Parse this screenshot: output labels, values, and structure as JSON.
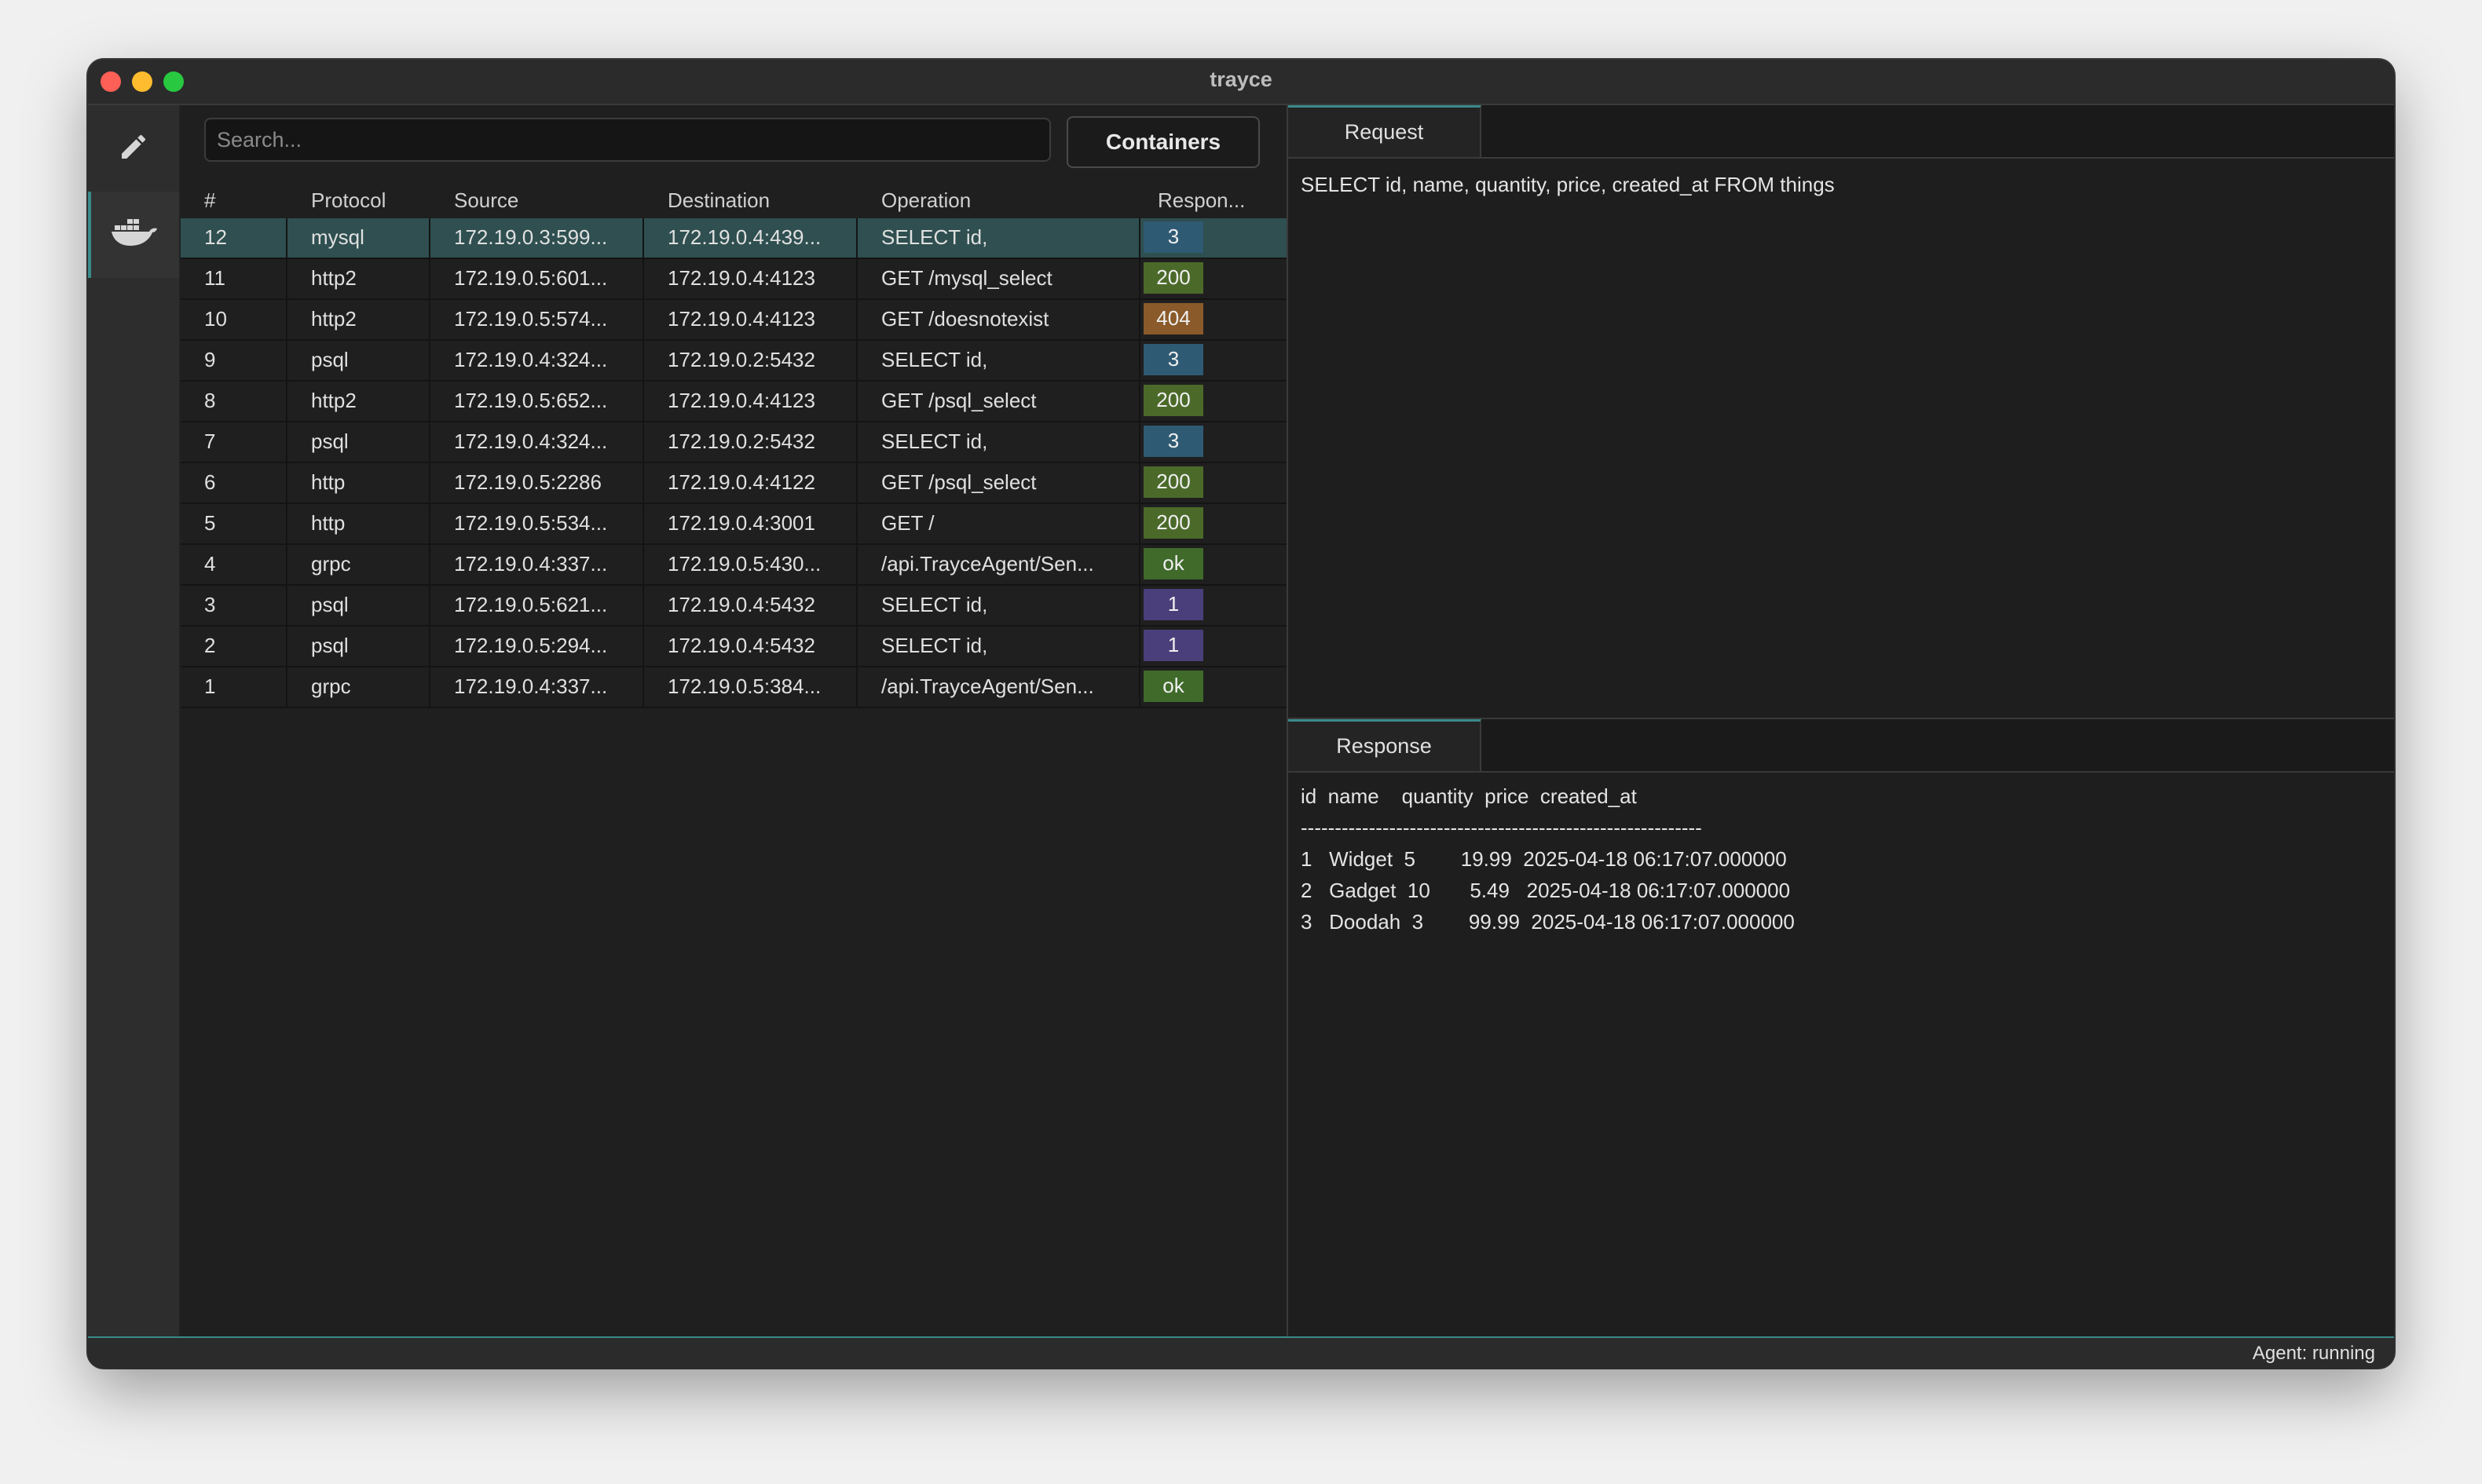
{
  "window": {
    "title": "trayce"
  },
  "sidebar": {
    "items": [
      {
        "icon": "pencil-icon",
        "active": false
      },
      {
        "icon": "docker-whale-icon",
        "active": true
      }
    ]
  },
  "toolbar": {
    "search_placeholder": "Search...",
    "containers_label": "Containers"
  },
  "table": {
    "headers": {
      "num": "#",
      "protocol": "Protocol",
      "source": "Source",
      "destination": "Destination",
      "operation": "Operation",
      "response": "Respon..."
    },
    "rows": [
      {
        "num": "12",
        "protocol": "mysql",
        "source": "172.19.0.3:599...",
        "destination": "172.19.0.4:439...",
        "operation": "SELECT id,",
        "response": "3",
        "badge_color": "#2f5a73",
        "selected": true
      },
      {
        "num": "11",
        "protocol": "http2",
        "source": "172.19.0.5:601...",
        "destination": "172.19.0.4:4123",
        "operation": "GET /mysql_select",
        "response": "200",
        "badge_color": "#4b6a2a"
      },
      {
        "num": "10",
        "protocol": "http2",
        "source": "172.19.0.5:574...",
        "destination": "172.19.0.4:4123",
        "operation": "GET /doesnotexist",
        "response": "404",
        "badge_color": "#8a5a2a"
      },
      {
        "num": "9",
        "protocol": "psql",
        "source": "172.19.0.4:324...",
        "destination": "172.19.0.2:5432",
        "operation": "SELECT id,",
        "response": "3",
        "badge_color": "#2f5a73"
      },
      {
        "num": "8",
        "protocol": "http2",
        "source": "172.19.0.5:652...",
        "destination": "172.19.0.4:4123",
        "operation": "GET /psql_select",
        "response": "200",
        "badge_color": "#4b6a2a"
      },
      {
        "num": "7",
        "protocol": "psql",
        "source": "172.19.0.4:324...",
        "destination": "172.19.0.2:5432",
        "operation": "SELECT id,",
        "response": "3",
        "badge_color": "#2f5a73"
      },
      {
        "num": "6",
        "protocol": "http",
        "source": "172.19.0.5:2286",
        "destination": "172.19.0.4:4122",
        "operation": "GET /psql_select",
        "response": "200",
        "badge_color": "#4b6a2a"
      },
      {
        "num": "5",
        "protocol": "http",
        "source": "172.19.0.5:534...",
        "destination": "172.19.0.4:3001",
        "operation": "GET /",
        "response": "200",
        "badge_color": "#4b6a2a"
      },
      {
        "num": "4",
        "protocol": "grpc",
        "source": "172.19.0.4:337...",
        "destination": "172.19.0.5:430...",
        "operation": "/api.TrayceAgent/Sen...",
        "response": "ok",
        "badge_color": "#3f6a2a"
      },
      {
        "num": "3",
        "protocol": "psql",
        "source": "172.19.0.5:621...",
        "destination": "172.19.0.4:5432",
        "operation": "SELECT id,",
        "response": "1",
        "badge_color": "#4a3f7a"
      },
      {
        "num": "2",
        "protocol": "psql",
        "source": "172.19.0.5:294...",
        "destination": "172.19.0.4:5432",
        "operation": "SELECT id,",
        "response": "1",
        "badge_color": "#4a3f7a"
      },
      {
        "num": "1",
        "protocol": "grpc",
        "source": "172.19.0.4:337...",
        "destination": "172.19.0.5:384...",
        "operation": "/api.TrayceAgent/Sen...",
        "response": "ok",
        "badge_color": "#3f6a2a"
      }
    ]
  },
  "request": {
    "tab_label": "Request",
    "body": "SELECT id, name, quantity, price, created_at FROM things"
  },
  "response": {
    "tab_label": "Response",
    "lines": [
      "id  name    quantity  price  created_at",
      "-----------------------------------------------------------",
      "1   Widget  5        19.99  2025-04-18 06:17:07.000000",
      "2   Gadget  10       5.49   2025-04-18 06:17:07.000000",
      "3   Doodah  3        99.99  2025-04-18 06:17:07.000000"
    ]
  },
  "status": {
    "text": "Agent: running"
  },
  "colors": {
    "accent": "#3a8a8a",
    "selected_row": "#2f4f50"
  }
}
